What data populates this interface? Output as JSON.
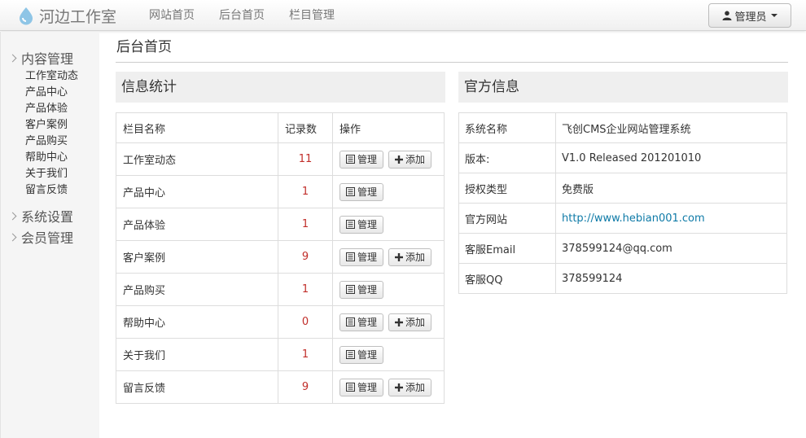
{
  "brand": {
    "name": "河边工作室",
    "logo_icon": "water-drop-icon"
  },
  "nav": {
    "items": [
      {
        "label": "网站首页"
      },
      {
        "label": "后台首页"
      },
      {
        "label": "栏目管理"
      }
    ]
  },
  "user_menu": {
    "label": "管理员",
    "icon": "user-icon"
  },
  "sidebar": {
    "groups": [
      {
        "label": "内容管理",
        "items": [
          {
            "label": "工作室动态"
          },
          {
            "label": "产品中心"
          },
          {
            "label": "产品体验"
          },
          {
            "label": "客户案例"
          },
          {
            "label": "产品购买"
          },
          {
            "label": "帮助中心"
          },
          {
            "label": "关于我们"
          },
          {
            "label": "留言反馈"
          }
        ]
      },
      {
        "label": "系统设置"
      },
      {
        "label": "会员管理"
      }
    ]
  },
  "page_title": "后台首页",
  "stats": {
    "title": "信息统计",
    "headers": {
      "name": "栏目名称",
      "count": "记录数",
      "action": "操作"
    },
    "manage_label": "管理",
    "add_label": "添加",
    "rows": [
      {
        "name": "工作室动态",
        "count": "11"
      },
      {
        "name": "产品中心",
        "count": "1"
      },
      {
        "name": "产品体验",
        "count": "1"
      },
      {
        "name": "客户案例",
        "count": "9"
      },
      {
        "name": "产品购买",
        "count": "1"
      },
      {
        "name": "帮助中心",
        "count": "0"
      },
      {
        "name": "关于我们",
        "count": "1"
      },
      {
        "name": "留言反馈",
        "count": "9"
      }
    ]
  },
  "official": {
    "title": "官方信息",
    "rows": [
      {
        "key": "系统名称",
        "value": "飞创CMS企业网站管理系统"
      },
      {
        "key": "版本:",
        "value": "V1.0 Released 201201010"
      },
      {
        "key": "授权类型",
        "value": "免费版"
      },
      {
        "key": "官方网站",
        "value": "http://www.hebian001.com"
      },
      {
        "key": "客服Email",
        "value": "378599124@qq.com"
      },
      {
        "key": "客服QQ",
        "value": "378599124"
      }
    ]
  },
  "colors": {
    "count_text": "#c12e2a",
    "link": "#0e7aa7",
    "sidebar_bg": "#f5f5f5",
    "panel_head_bg": "#efefef"
  }
}
